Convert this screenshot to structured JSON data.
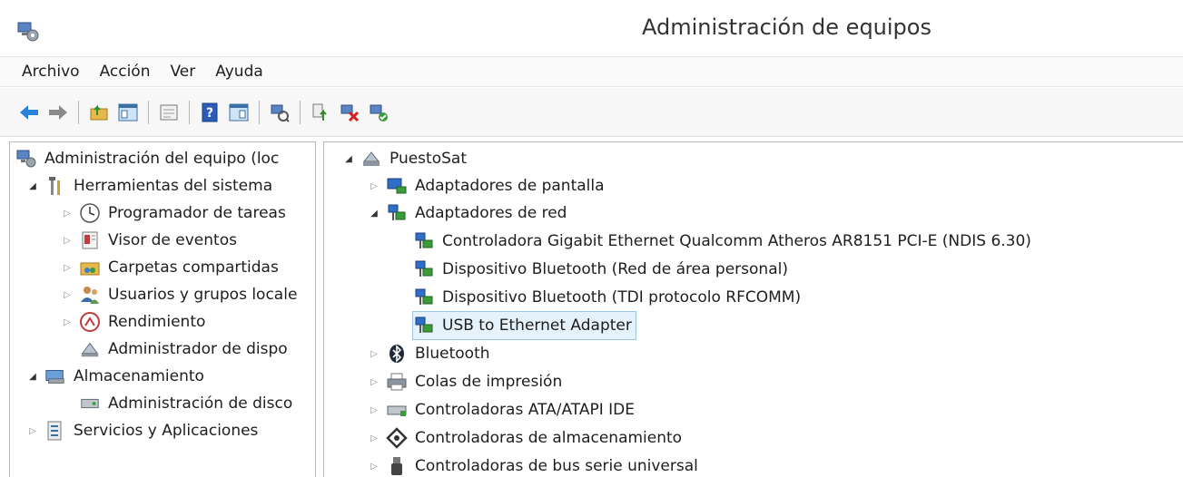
{
  "window": {
    "title": "Administración de equipos"
  },
  "menu": [
    "Archivo",
    "Acción",
    "Ver",
    "Ayuda"
  ],
  "left_tree": {
    "root": "Administración del equipo (loc",
    "system_tools": "Herramientas del sistema",
    "task_scheduler": "Programador de tareas",
    "event_viewer": "Visor de eventos",
    "shared_folders": "Carpetas compartidas",
    "local_users": "Usuarios y grupos locale",
    "performance": "Rendimiento",
    "device_manager": "Administrador de dispo",
    "storage": "Almacenamiento",
    "disk_management": "Administración de disco",
    "services_apps": "Servicios y Aplicaciones"
  },
  "right_tree": {
    "computer": "PuestoSat",
    "display_adapters": "Adaptadores de pantalla",
    "network_adapters": "Adaptadores de red",
    "net_items": [
      "Controladora Gigabit Ethernet Qualcomm Atheros AR8151 PCI-E (NDIS 6.30)",
      "Dispositivo Bluetooth (Red de área personal)",
      "Dispositivo Bluetooth (TDI protocolo RFCOMM)",
      "USB to Ethernet Adapter"
    ],
    "bluetooth": "Bluetooth",
    "print_queues": "Colas de impresión",
    "ata_controllers": "Controladoras ATA/ATAPI IDE",
    "storage_controllers": "Controladoras de almacenamiento",
    "usb_controllers": "Controladoras de bus serie universal"
  }
}
